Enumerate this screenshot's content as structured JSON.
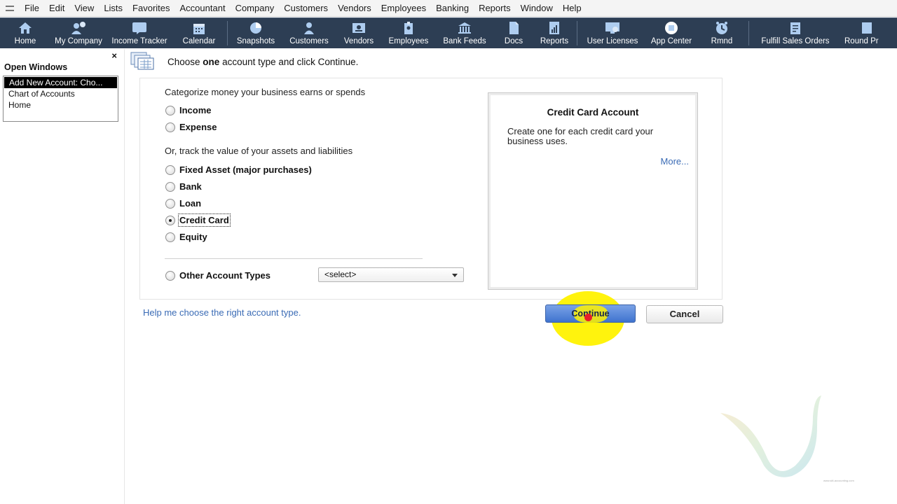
{
  "menu": [
    "File",
    "Edit",
    "View",
    "Lists",
    "Favorites",
    "Accountant",
    "Company",
    "Customers",
    "Vendors",
    "Employees",
    "Banking",
    "Reports",
    "Window",
    "Help"
  ],
  "toolbar": [
    {
      "label": "Home",
      "icon": "home-icon"
    },
    {
      "label": "My Company",
      "icon": "my-company-icon"
    },
    {
      "label": "Income Tracker",
      "icon": "income-tracker-icon"
    },
    {
      "label": "Calendar",
      "icon": "calendar-icon"
    },
    {
      "label": "Snapshots",
      "icon": "snapshots-icon"
    },
    {
      "label": "Customers",
      "icon": "customers-icon"
    },
    {
      "label": "Vendors",
      "icon": "vendors-icon"
    },
    {
      "label": "Employees",
      "icon": "employees-icon"
    },
    {
      "label": "Bank Feeds",
      "icon": "bank-feeds-icon"
    },
    {
      "label": "Docs",
      "icon": "docs-icon"
    },
    {
      "label": "Reports",
      "icon": "reports-icon"
    },
    {
      "label": "User Licenses",
      "icon": "user-licenses-icon"
    },
    {
      "label": "App Center",
      "icon": "app-center-icon"
    },
    {
      "label": "Rmnd",
      "icon": "reminders-icon"
    },
    {
      "label": "Fulfill Sales Orders",
      "icon": "fulfill-sales-orders-icon"
    },
    {
      "label": "Round Pr",
      "icon": "round-pr-icon"
    }
  ],
  "open_windows": {
    "close": "×",
    "title": "Open Windows",
    "items": [
      "Add New Account: Cho...",
      "Chart of Accounts",
      "Home"
    ],
    "selected_index": 0
  },
  "dialog": {
    "prompt_before": "Choose ",
    "prompt_bold": "one",
    "prompt_after": " account type and click Continue.",
    "section1_label": "Categorize money your business earns or spends",
    "section2_label": "Or, track the value of your assets and liabilities",
    "options": {
      "income": "Income",
      "expense": "Expense",
      "fixed_asset": "Fixed Asset (major purchases)",
      "bank": "Bank",
      "loan": "Loan",
      "credit_card": "Credit Card",
      "equity": "Equity",
      "other": "Other Account Types"
    },
    "selected_option": "Credit Card",
    "other_select_value": "<select>",
    "info": {
      "title": "Credit Card Account",
      "description": "Create one for each credit card your business uses.",
      "more_link": "More..."
    },
    "help_link": "Help me choose the right account type.",
    "continue_button": "Continue",
    "cancel_button": "Cancel"
  },
  "colors": {
    "toolbar_bg": "#2d3e54",
    "link": "#3a6bb5",
    "continue_bg": "#3f73cf",
    "cursor_highlight": "#fff200",
    "cursor_dot": "#e8202a"
  },
  "watermark": {
    "url": "www.siti-accounting.com"
  }
}
